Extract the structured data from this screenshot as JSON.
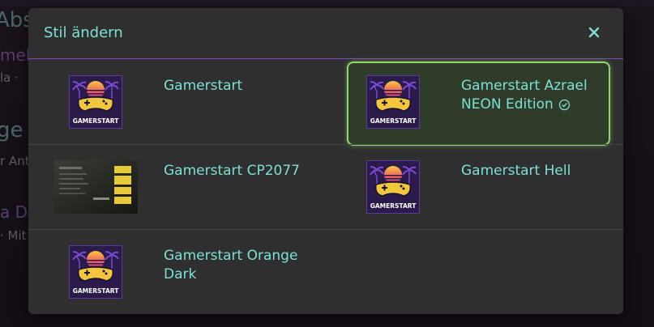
{
  "background": {
    "lines": [
      {
        "text": "Abs",
        "cls": "bg-h"
      },
      {
        "text": "mel",
        "cls": "bg-link"
      },
      {
        "text": "la ·",
        "cls": "bg-sub"
      },
      {
        "text": "ge",
        "cls": "bg-h"
      },
      {
        "text": "r Ant",
        "cls": "bg-sub"
      },
      {
        "text": "a Do",
        "cls": "bg-link"
      },
      {
        "text": "· Mit",
        "cls": "bg-sub"
      }
    ]
  },
  "modal": {
    "title": "Stil ändern",
    "close_icon": "close-icon"
  },
  "styles": [
    {
      "label": "Gamerstart",
      "thumb": "gamerstart-logo",
      "selected": false
    },
    {
      "label": "Gamerstart Azrael NEON Edition",
      "thumb": "gamerstart-logo",
      "selected": true
    },
    {
      "label": "Gamerstart CP2077",
      "thumb": "cp2077-screenshot",
      "selected": false
    },
    {
      "label": "Gamerstart Hell",
      "thumb": "gamerstart-logo",
      "selected": false
    },
    {
      "label": "Gamerstart Orange Dark",
      "thumb": "gamerstart-logo",
      "selected": false
    }
  ],
  "logo": {
    "text": "GAMERSTART"
  },
  "colors": {
    "accent": "#7de0d5",
    "border": "#7a4fb5",
    "selected": "#8fd66a",
    "modal_bg": "#2f2f2f"
  }
}
